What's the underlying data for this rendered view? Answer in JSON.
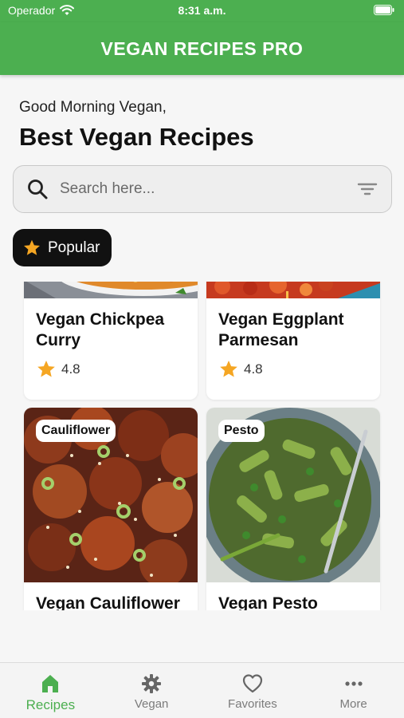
{
  "status_bar": {
    "carrier": "Operador",
    "time": "8:31 a.m."
  },
  "app_bar": {
    "title": "VEGAN RECIPES PRO",
    "color": "#4caf50"
  },
  "greeting": "Good Morning Vegan,",
  "headline": "Best Vegan Recipes",
  "search": {
    "placeholder": "Search here...",
    "value": ""
  },
  "filter_chip": {
    "label": "Popular",
    "icon": "star-icon"
  },
  "recipes": [
    {
      "title": "Vegan Chickpea Curry",
      "rating": "4.8",
      "tag": ""
    },
    {
      "title": "Vegan Eggplant Parmesan",
      "rating": "4.8",
      "tag": ""
    },
    {
      "title": "Vegan Cauliflower",
      "rating": "",
      "tag": "Cauliflower"
    },
    {
      "title": "Vegan Pesto",
      "rating": "",
      "tag": "Pesto"
    }
  ],
  "bottom_nav": {
    "items": [
      {
        "label": "Recipes",
        "icon": "home-icon",
        "active": true
      },
      {
        "label": "Vegan",
        "icon": "gear-icon",
        "active": false
      },
      {
        "label": "Favorites",
        "icon": "heart-icon",
        "active": false
      },
      {
        "label": "More",
        "icon": "more-icon",
        "active": false
      }
    ]
  }
}
